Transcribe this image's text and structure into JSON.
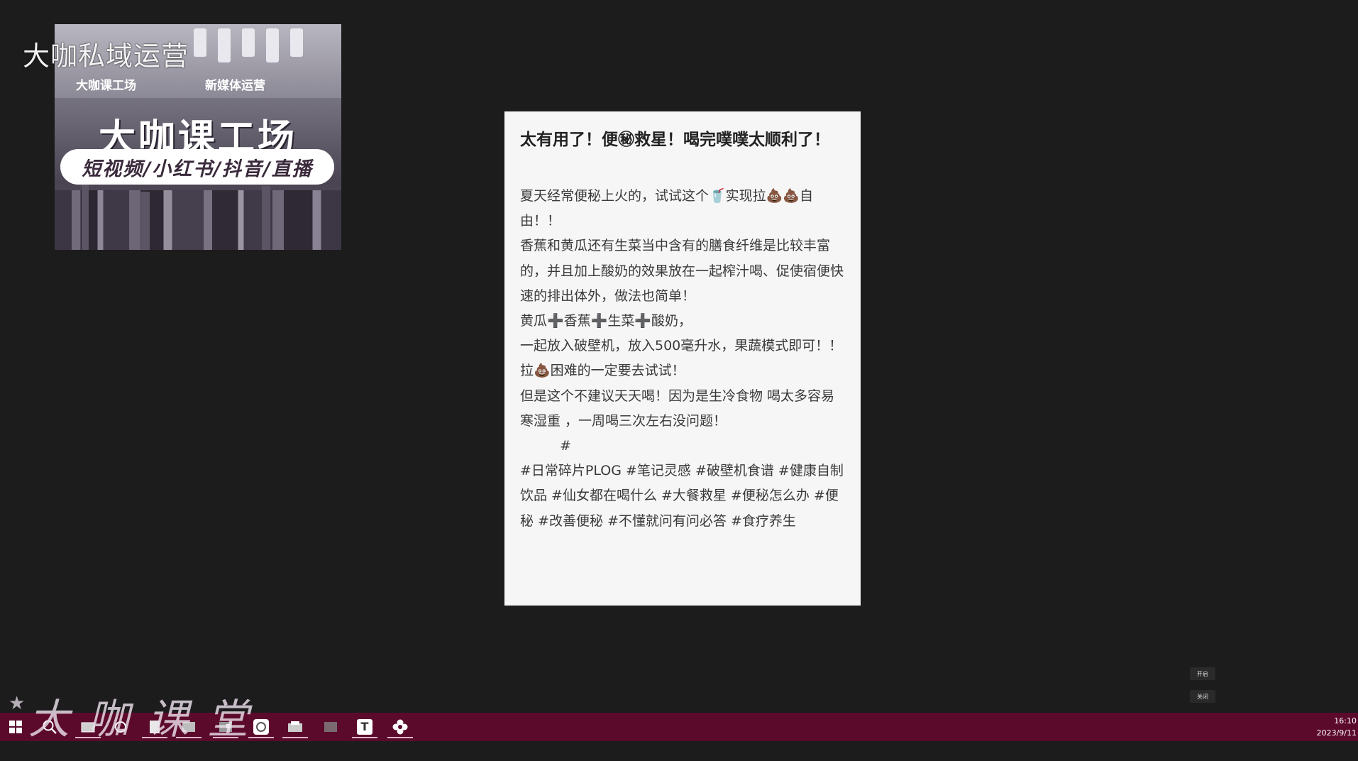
{
  "watermark_top": "大咖私域运营",
  "watermark_bottom": "大咖课堂",
  "banner": {
    "chip_left": "大咖课工场",
    "chip_right": "新媒体运营",
    "title": "大咖课工场",
    "subtitle": "短视频/小红书/抖音/直播"
  },
  "post": {
    "title": "太有用了！便㊙救星！喝完噗噗太顺利了！",
    "paragraphs": [
      "夏天经常便秘上火的，试试这个🥤实现拉💩💩自由！！",
      "香蕉和黄瓜还有生菜当中含有的膳食纤维是比较丰富的，并且加上酸奶的效果放在一起榨汁喝、促使宿便快速的排出体外，做法也简单！",
      "黄瓜➕香蕉➕生菜➕酸奶，",
      "一起放入破壁机，放入500毫升水，果蔬模式即可！！",
      "拉💩困难的一定要去试试！",
      "但是这个不建议天天喝！因为是生冷食物 喝太多容易寒湿重 ，一周喝三次左右没问题！"
    ],
    "tag_mark": "#",
    "tags": "#日常碎片PLOG #笔记灵感 #破壁机食谱 #健康自制饮品 #仙女都在喝什么 #大餐救星 #便秘怎么办 #便秘 #改善便秘 #不懂就问有问必答 #食疗养生"
  },
  "float_buttons": [
    "开启",
    "关闭"
  ],
  "taskbar": {
    "icons": [
      "windows-start-icon",
      "search-icon",
      "task-view-icon",
      "cortana-icon",
      "file-icon",
      "image-viewer-icon",
      "media-player-icon",
      "browser-icon",
      "printer-icon",
      "app-icon",
      "text-editor-icon",
      "settings-flower-icon"
    ],
    "text_editor_glyph": "T",
    "time": "16:10",
    "date": "2023/9/11"
  },
  "colors": {
    "background": "#1c1c1c",
    "taskbar": "#5b0a2c",
    "card": "#f6f6f6"
  }
}
